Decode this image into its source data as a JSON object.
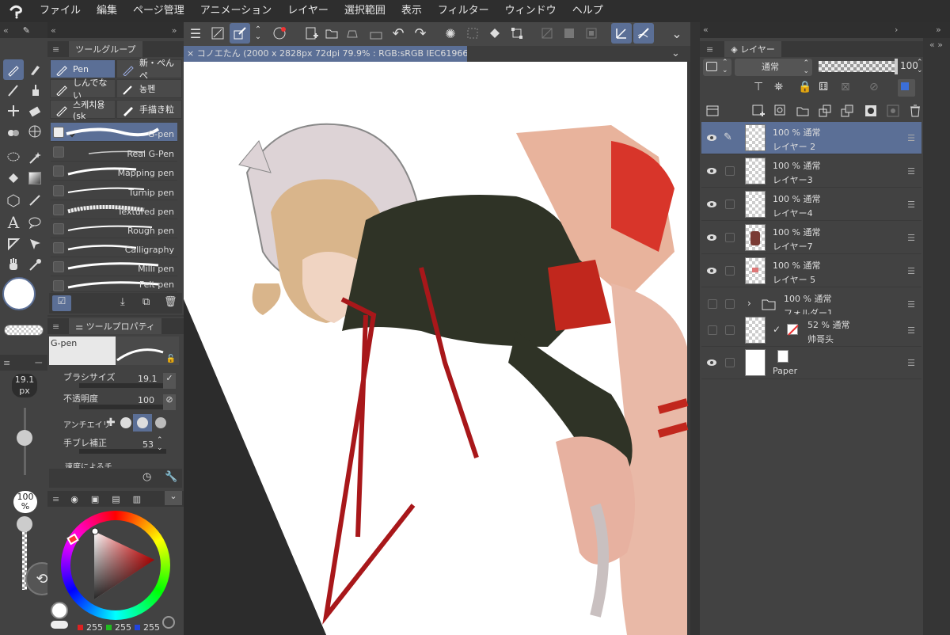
{
  "menu": [
    "ファイル",
    "編集",
    "ページ管理",
    "アニメーション",
    "レイヤー",
    "選択範囲",
    "表示",
    "フィルター",
    "ウィンドウ",
    "ヘルプ"
  ],
  "document_tab": "コノエたん (2000 x 2828px 72dpi 79.9% : RGB:sRGB IEC61966-2.1)",
  "tool_group": {
    "title": "ツールグループ",
    "subtools": [
      "Pen",
      "新・ぺんぺ",
      "しんでない",
      "농펜",
      "스케치용(sk",
      "手描き粒"
    ]
  },
  "brushes": [
    "G-pen",
    "Real G-Pen",
    "Mapping pen",
    "Turnip pen",
    "Textured pen",
    "Rough pen",
    "Calligraphy",
    "Milli pen",
    "Felt pen"
  ],
  "tool_property": {
    "title": "ツールプロパティ",
    "current": "G-pen",
    "brush_size_label": "ブラシサイズ",
    "brush_size": "19.1",
    "opacity_label": "不透明度",
    "opacity": "100",
    "antialias_label": "アンチエイリ",
    "stabilize_label": "手ブレ補正",
    "stabilize": "53",
    "speed_label": "速度によるチ..."
  },
  "size_slider": {
    "value": "19.1",
    "unit": "px",
    "opacity": "100",
    "opacity_unit": "%"
  },
  "color": {
    "r": "255",
    "g": "255",
    "b": "255"
  },
  "layers_panel": {
    "title": "レイヤー",
    "blend": "通常",
    "opacity": "100",
    "layers": [
      {
        "pct": "100 % 通常",
        "name": "レイヤー 2",
        "selected": true
      },
      {
        "pct": "100 % 通常",
        "name": "レイヤー3"
      },
      {
        "pct": "100 % 通常",
        "name": "レイヤー4"
      },
      {
        "pct": "100 % 通常",
        "name": "レイヤー7"
      },
      {
        "pct": "100 % 通常",
        "name": "レイヤー 5"
      },
      {
        "pct": "100 % 通常",
        "name": "フォルダー1"
      },
      {
        "pct": "52 % 通常",
        "name": "帅哥头"
      },
      {
        "pct": "",
        "name": "Paper"
      }
    ]
  }
}
